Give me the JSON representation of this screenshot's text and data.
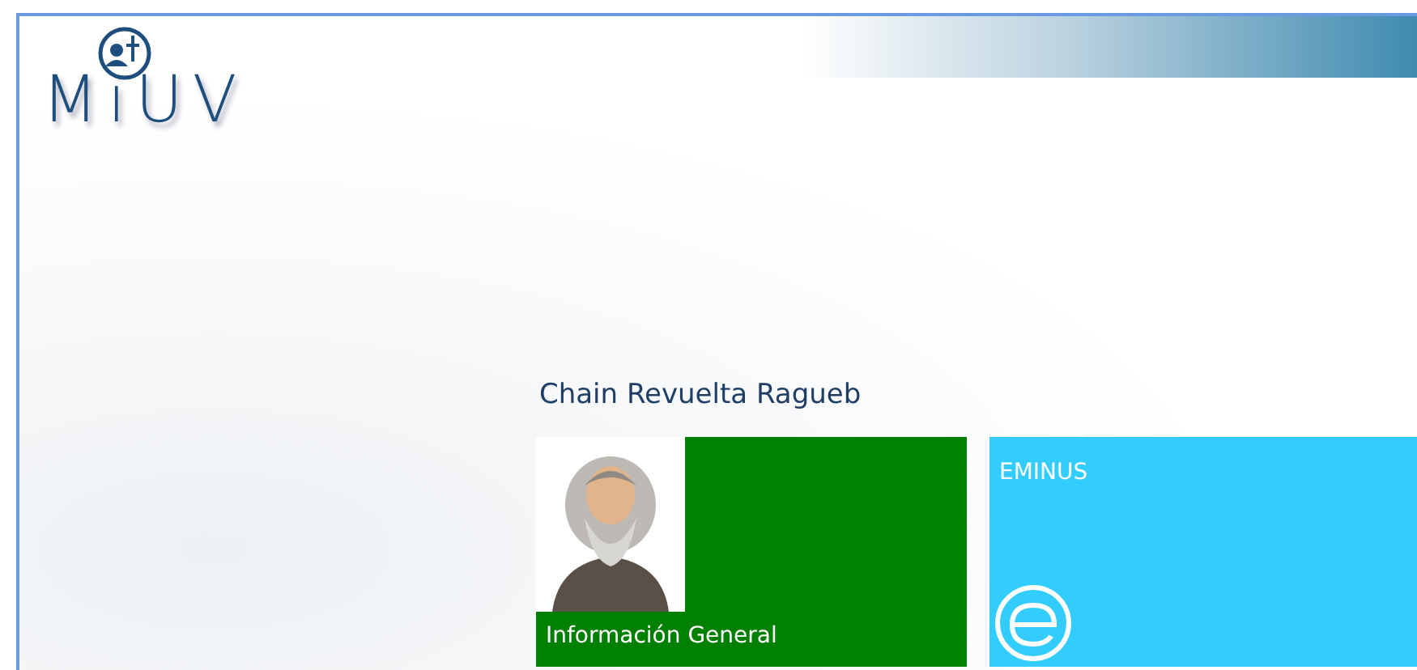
{
  "header": {
    "logo": "MiUV"
  },
  "user": {
    "name": "Chain Revuelta Ragueb"
  },
  "tiles": [
    {
      "kind": "profile",
      "label": "Información General",
      "color": "#008000"
    },
    {
      "kind": "app",
      "label": "EMINUS",
      "color": "#33ccff"
    }
  ]
}
